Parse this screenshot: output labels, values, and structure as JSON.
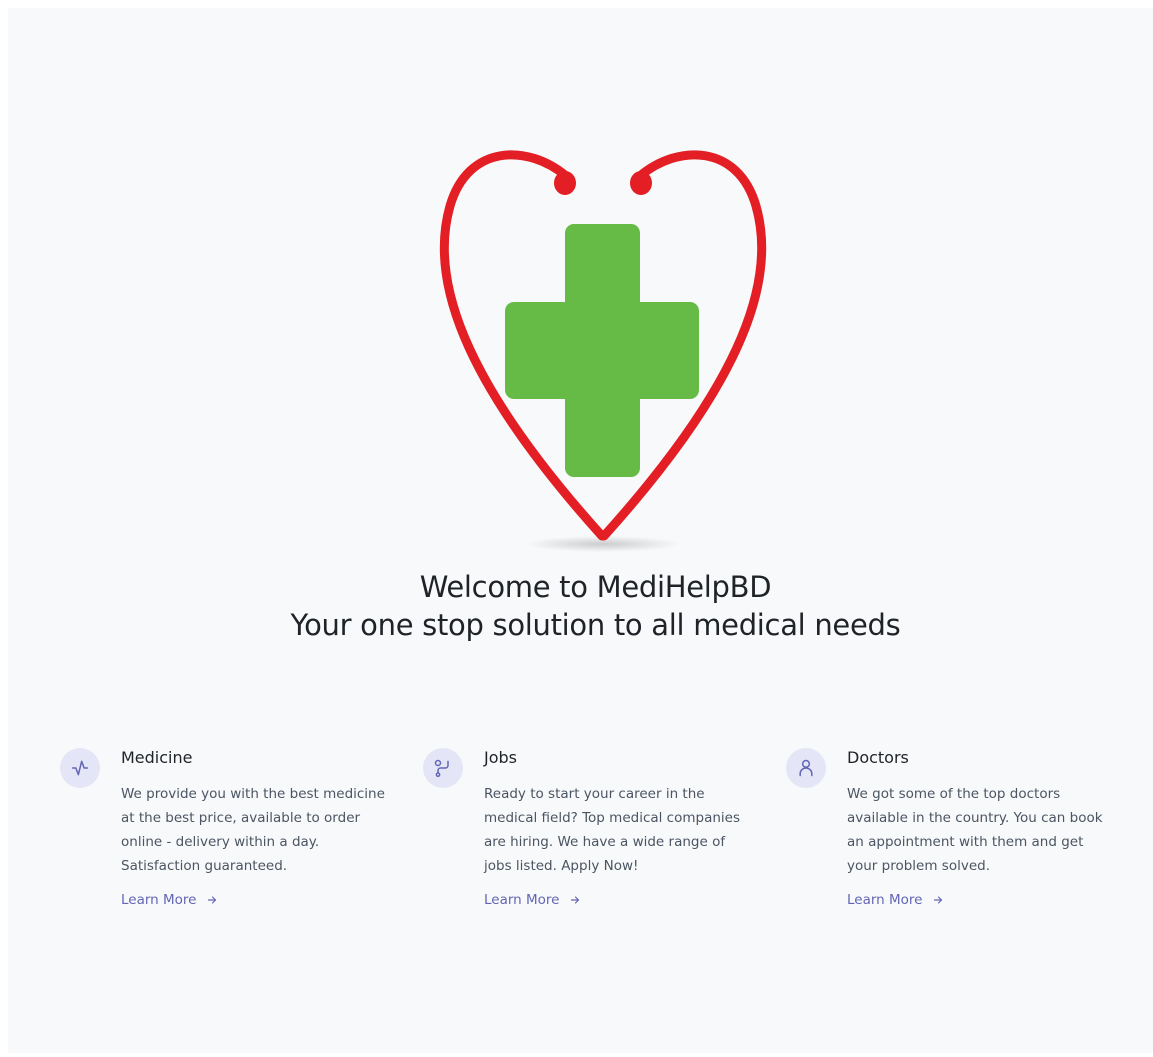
{
  "hero": {
    "line1": "Welcome to MediHelpBD",
    "line2": "Your one stop solution to all medical needs"
  },
  "colors": {
    "heart": "#e31e24",
    "cross": "#66bb46",
    "accent": "#6366b5",
    "icon_bg": "#e4e6f7",
    "page_bg": "#f8f9fa"
  },
  "features": [
    {
      "icon": "pulse-icon",
      "title": "Medicine",
      "description": "We provide you with the best medicine at the best price, available to order online - delivery within a day. Satisfaction guaranteed.",
      "link": "Learn More"
    },
    {
      "icon": "stethoscope-icon",
      "title": "Jobs",
      "description": "Ready to start your career in the medical field? Top medical companies are hiring. We have a wide range of jobs listed. Apply Now!",
      "link": "Learn More"
    },
    {
      "icon": "user-icon",
      "title": "Doctors",
      "description": "We got some of the top doctors available in the country. You can book an appointment with them and get your problem solved.",
      "link": "Learn More"
    }
  ]
}
